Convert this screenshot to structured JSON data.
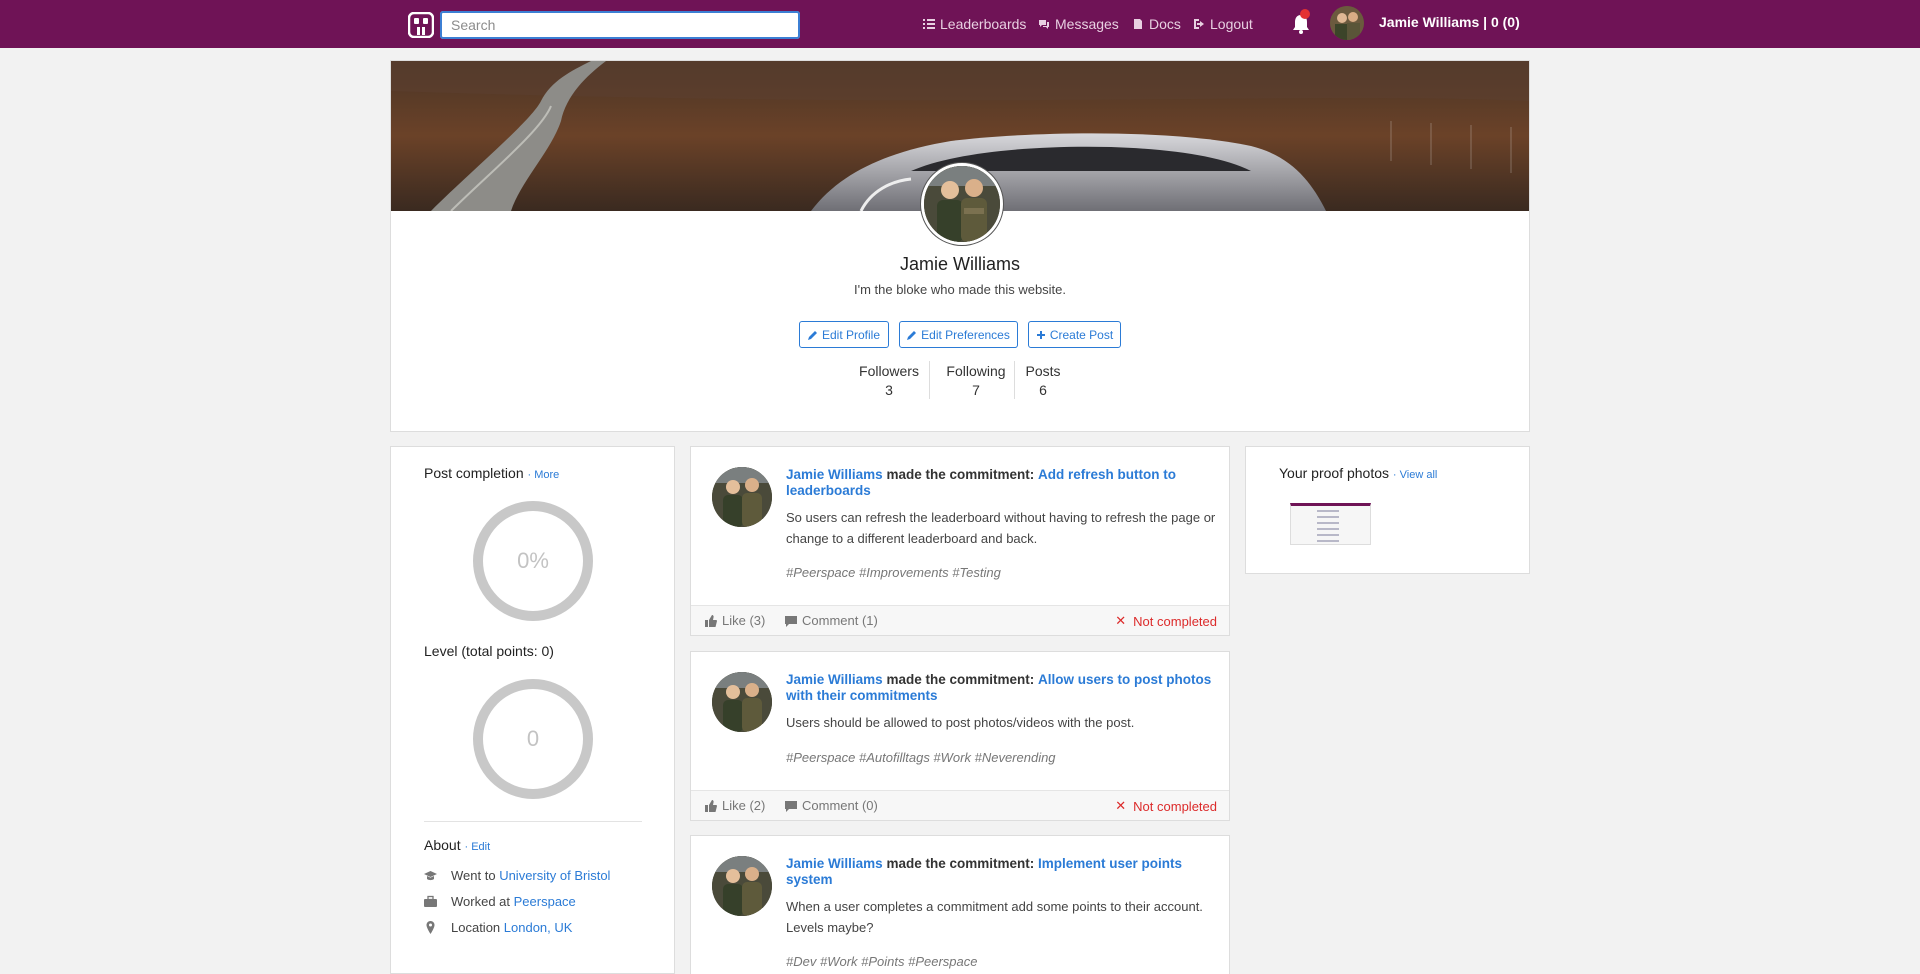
{
  "navbar": {
    "search_placeholder": "Search",
    "links": [
      {
        "label": "Leaderboards",
        "icon": "list-icon"
      },
      {
        "label": "Messages",
        "icon": "messages-icon"
      },
      {
        "label": "Docs",
        "icon": "docs-icon"
      },
      {
        "label": "Logout",
        "icon": "logout-icon"
      }
    ],
    "user_label": "Jamie Williams | 0 (0)"
  },
  "profile": {
    "name": "Jamie Williams",
    "bio": "I'm the bloke who made this website.",
    "buttons": {
      "edit_profile": "Edit Profile",
      "edit_preferences": "Edit Preferences",
      "create_post": "Create Post"
    },
    "stats": [
      {
        "label": "Followers",
        "value": "3"
      },
      {
        "label": "Following",
        "value": "7"
      },
      {
        "label": "Posts",
        "value": "6"
      }
    ]
  },
  "left": {
    "post_completion": {
      "title": "Post completion",
      "more": "· More",
      "value": "0%"
    },
    "level": {
      "title": "Level (total points: 0)",
      "value": "0"
    },
    "about": {
      "title": "About",
      "edit": "· Edit",
      "rows": [
        {
          "prefix": "Went to",
          "link": "University of Bristol",
          "icon": "graduation-cap-icon"
        },
        {
          "prefix": "Worked at",
          "link": "Peerspace",
          "icon": "briefcase-icon"
        },
        {
          "prefix": "Location",
          "link": "London, UK",
          "icon": "map-pin-icon"
        }
      ]
    }
  },
  "posts": [
    {
      "author": "Jamie Williams",
      "made": "made the commitment:",
      "commitment": "Add refresh button to leaderboards",
      "body": "So users can refresh the leaderboard without having to refresh the page or change to a different leaderboard and back.",
      "tags": "#Peerspace #Improvements #Testing",
      "like": "Like (3)",
      "comment": "Comment (1)",
      "status": "Not completed"
    },
    {
      "author": "Jamie Williams",
      "made": "made the commitment:",
      "commitment": "Allow users to post photos with their commitments",
      "body": "Users should be allowed to post photos/videos with the post.",
      "tags": "#Peerspace #Autofilltags #Work #Neverending",
      "like": "Like (2)",
      "comment": "Comment (0)",
      "status": "Not completed"
    },
    {
      "author": "Jamie Williams",
      "made": "made the commitment:",
      "commitment": "Implement user points system",
      "body": "When a user completes a commitment add some points to their account. Levels maybe?",
      "tags": "#Dev #Work #Points #Peerspace"
    }
  ],
  "right": {
    "title": "Your proof photos",
    "view_all": "· View all"
  },
  "colors": {
    "navbar": "#6f1356",
    "link": "#2b7bd6",
    "not_completed": "#dc2b2b"
  }
}
